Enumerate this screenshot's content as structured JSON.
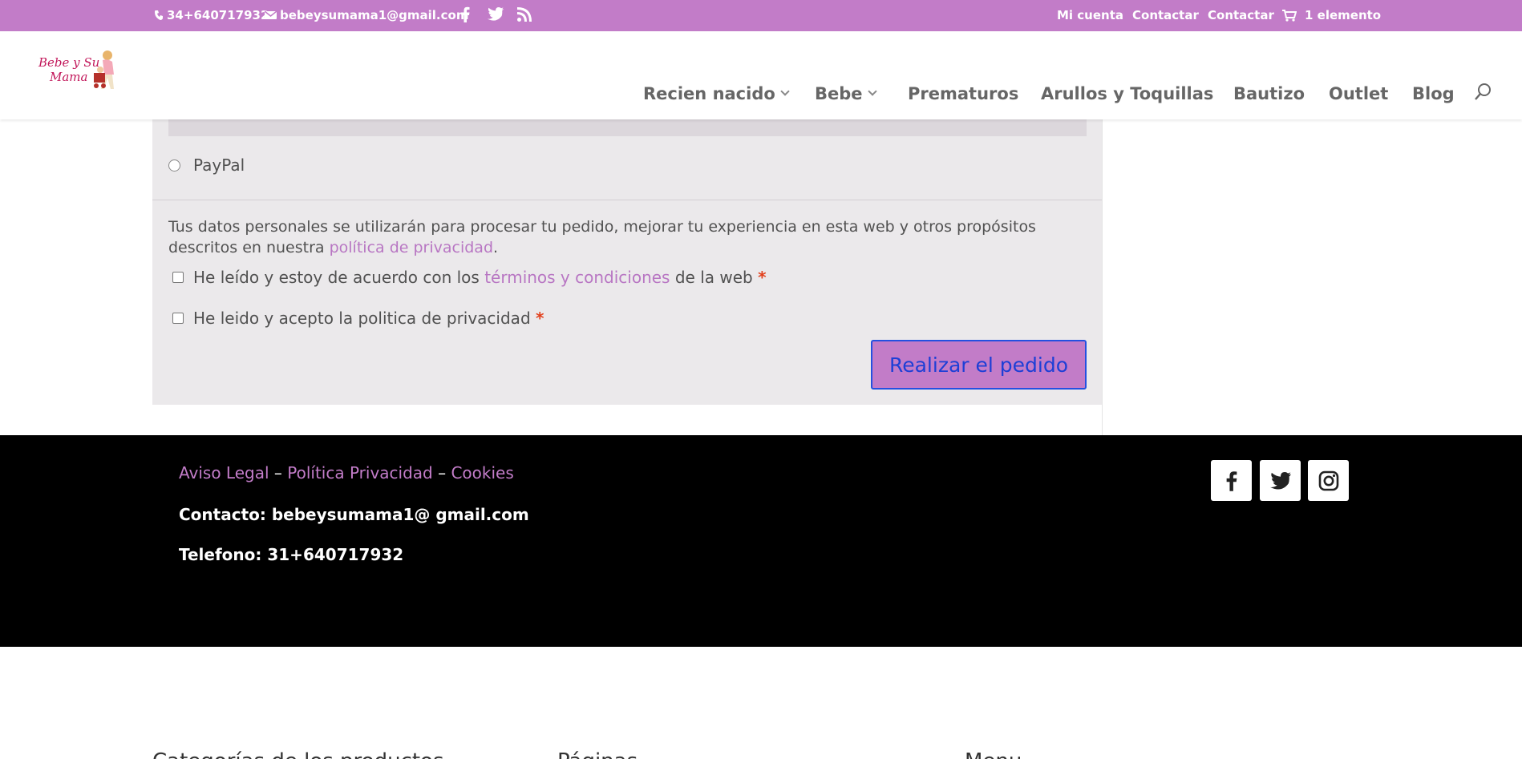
{
  "topbar": {
    "phone": "34+640717932",
    "email": "bebeysumama1@gmail.com",
    "links": [
      "Mi cuenta",
      "Contactar",
      "Contactar"
    ],
    "cart": "1 elemento"
  },
  "header": {
    "logo_text_line1": "Bebe y Su",
    "logo_text_line2": "Mama",
    "nav": [
      "Recien nacido",
      "Bebe",
      "Prematuros",
      "Arullos y Toquillas",
      "Bautizo",
      "Outlet",
      "Blog"
    ]
  },
  "checkout": {
    "paypal_label": "PayPal",
    "privacy_text_before": "Tus datos personales se utilizarán para procesar tu pedido, mejorar tu experiencia en esta web y otros propósitos descritos en nuestra ",
    "privacy_link": "política de privacidad",
    "privacy_text_after": ".",
    "terms_before": "He leído y estoy de acuerdo con los ",
    "terms_link": "términos y condiciones",
    "terms_after": " de la web",
    "privacy_accept": "He leido y acepto la politica de privacidad",
    "required_mark": "*",
    "place_order": "Realizar el pedido"
  },
  "footer": {
    "legal_links": [
      "Aviso Legal",
      "Política Privacidad",
      "Cookies"
    ],
    "separator": "–",
    "contact": "Contacto: bebeysumama1@ gmail.com",
    "phone": "Telefono: 31+640717932"
  },
  "widgets": {
    "titles": [
      "Categorías de los productos",
      "Páginas",
      "Menu"
    ]
  },
  "colors": {
    "brand": "#c27cc8",
    "footer_bg": "#000000",
    "button_text": "#1d3fd6"
  }
}
